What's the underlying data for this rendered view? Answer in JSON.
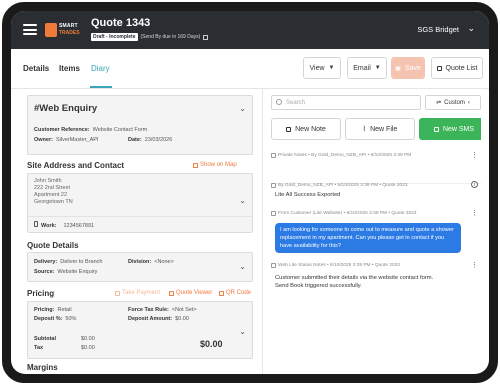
{
  "header": {
    "logo_line1": "SMART",
    "logo_line2": "TRADES",
    "quote_title": "Quote 1343",
    "badge": "Draft - Incomplete",
    "subtitle": "(Send By due in 169 Days)",
    "company": "SGS Bridget"
  },
  "tabs": [
    "Details",
    "Items",
    "Diary"
  ],
  "active_tab": "Diary",
  "toolbar": {
    "view": "View",
    "email": "Email",
    "save": "Save",
    "quote_list": "Quote List"
  },
  "left": {
    "enquiry": {
      "title": "#Web Enquiry",
      "customer_ref_label": "Customer Reference:",
      "customer_ref_value": "Website Contact Form",
      "owner_label": "Owner:",
      "owner_value": "SilverMaster_API",
      "date_label": "Date:",
      "date_value": "23/03/2026"
    },
    "site": {
      "title": "Site Address and Contact",
      "map_link": "Show on Map",
      "address": [
        "John Smith",
        "222 2nd Street",
        "Apartment 22",
        "Georgetown TN"
      ],
      "work_label": "Work:",
      "work_value": "1234567891"
    },
    "quote_details": {
      "title": "Quote Details",
      "delivery_label": "Delivery:",
      "delivery_value": "Deliver to Branch",
      "source_label": "Source:",
      "source_value": "Website Enquiry",
      "division_label": "Division:",
      "division_value": "<None>"
    },
    "pricing": {
      "title": "Pricing",
      "table_payment": "Take Payment",
      "quote_viewer": "Quote Viewer",
      "qr_code": "QR Code",
      "pricing_label": "Pricing:",
      "pricing_value": "Retail",
      "deposit_pct_label": "Deposit %:",
      "deposit_pct_value": "50%",
      "force_tax_label": "Force Tax Rule:",
      "force_tax_value": "<Not Set>",
      "deposit_amt_label": "Deposit Amount:",
      "deposit_amt_value": "$0.00",
      "subtotal_label": "Subtotal",
      "subtotal_value": "$0.00",
      "tax_label": "Tax",
      "tax_value": "$0.00",
      "total_value": "$0.00"
    },
    "margins_title": "Margins"
  },
  "diary": {
    "search_placeholder": "Search",
    "custom": "Custom",
    "new_note": "New Note",
    "new_file": "New File",
    "new_sms": "New SMS",
    "notes": [
      {
        "meta": "Private Notes • By Gold_Demo_NZB_API • 6/10/2025 3:39 PM",
        "body": "Lite All Success Exported"
      },
      {
        "meta": "By Gold_Demo_NZB_API • 6/10/2025 3:39 PM • Quote 2023",
        "body": "Lite All Success Exported"
      },
      {
        "meta": "From Customer (Lite Website) • 6/10/2025 3:39 PM • Quote 2023",
        "body": "I am looking for someone to come out to measure and quote a shower replacement in my apartment. Can you please get in contact if you have availability for this?"
      },
      {
        "meta": "Web Lite Status Notes • 6/10/2025 3:39 PM • Quote 2023",
        "body_lines": [
          "Customer submitted their details via the website contact form.",
          "Send Book triggered successfully."
        ]
      }
    ]
  },
  "colors": {
    "topbar": "#2a2e33",
    "accent_teal": "#3aa6b9",
    "accent_orange": "#f07a3a",
    "sms_green": "#3cb55a",
    "bubble_blue": "#2c7be5"
  }
}
